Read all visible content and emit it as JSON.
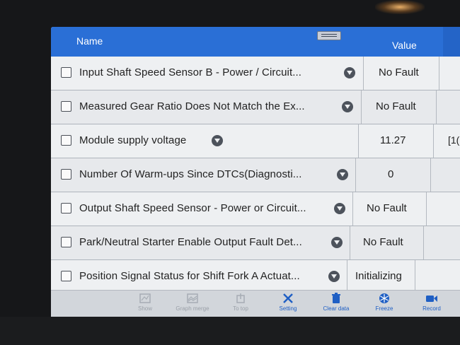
{
  "header": {
    "name_label": "Name",
    "value_label": "Value"
  },
  "rows": [
    {
      "name": "Input Shaft Speed Sensor B - Power / Circuit...",
      "value": "No Fault",
      "extra": ""
    },
    {
      "name": "Measured Gear Ratio Does Not Match the Ex...",
      "value": "No Fault",
      "extra": ""
    },
    {
      "name": "Module supply voltage",
      "value": "11.27",
      "extra": "[1("
    },
    {
      "name": "Number Of Warm-ups Since DTCs(Diagnosti...",
      "value": "0",
      "extra": ""
    },
    {
      "name": "Output Shaft Speed Sensor - Power or Circuit...",
      "value": "No Fault",
      "extra": ""
    },
    {
      "name": "Park/Neutral Starter Enable Output Fault Det...",
      "value": "No Fault",
      "extra": ""
    },
    {
      "name": "Position Signal Status for Shift Fork A Actuat...",
      "value": "Initializing",
      "extra": ""
    }
  ],
  "toolbar": {
    "show": "Show",
    "graph_merge": "Graph merge",
    "to_top": "To top",
    "setting": "Setting",
    "clear_data": "Clear data",
    "freeze": "Freeze",
    "record": "Record"
  },
  "colors": {
    "header_blue": "#2a6fd6",
    "enabled_blue": "#1f5fc4",
    "disabled_gray": "#9aa0a8"
  },
  "icons": [
    "dropdown-icon",
    "show-icon",
    "graph-merge-icon",
    "to-top-icon",
    "setting-icon",
    "clear-data-icon",
    "freeze-icon",
    "record-icon"
  ]
}
